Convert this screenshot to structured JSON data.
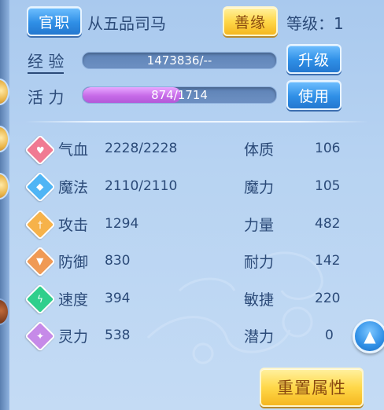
{
  "header": {
    "official_button": "官职",
    "rank_title": "从五品司马",
    "karma_button": "善缘",
    "level_label": "等级：",
    "level_value": "1"
  },
  "experience": {
    "label": "经 验",
    "bar_text": "1473836/--",
    "upgrade_button": "升级"
  },
  "vitality": {
    "label": "活 力",
    "current": 874,
    "max": 1714,
    "bar_text": "874/1714",
    "use_button": "使用"
  },
  "stats_left": [
    {
      "label": "气血",
      "value": "2228/2228",
      "icon": "heart-icon",
      "color": "#f07a92"
    },
    {
      "label": "魔法",
      "value": "2110/2110",
      "icon": "mana-diamond-icon",
      "color": "#4fb5f5"
    },
    {
      "label": "攻击",
      "value": "1294",
      "icon": "sword-icon",
      "color": "#f6b24a"
    },
    {
      "label": "防御",
      "value": "830",
      "icon": "shield-icon",
      "color": "#f09a55"
    },
    {
      "label": "速度",
      "value": "394",
      "icon": "lightning-icon",
      "color": "#2fcf8c"
    },
    {
      "label": "灵力",
      "value": "538",
      "icon": "spirit-flower-icon",
      "color": "#c68ae8"
    }
  ],
  "stats_right": [
    {
      "label": "体质",
      "value": "106"
    },
    {
      "label": "魔力",
      "value": "105"
    },
    {
      "label": "力量",
      "value": "482"
    },
    {
      "label": "耐力",
      "value": "142"
    },
    {
      "label": "敏捷",
      "value": "220"
    },
    {
      "label": "潜力",
      "value": "0"
    }
  ],
  "actions": {
    "reset_button": "重置属性",
    "scroll_up_icon": "arrow-up-icon"
  }
}
